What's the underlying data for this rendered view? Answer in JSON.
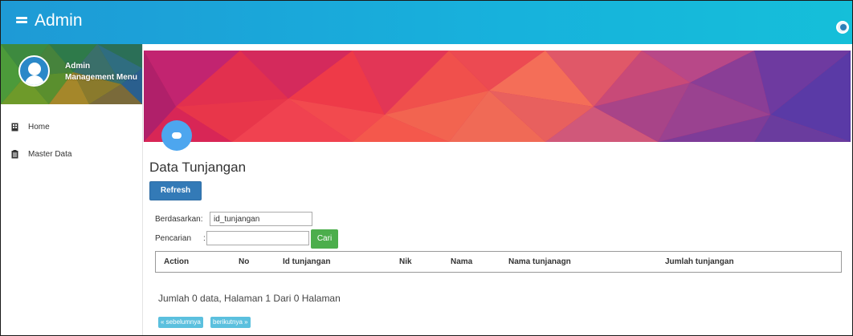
{
  "topbar": {
    "title": "Admin",
    "menu_icon": "menu-icon",
    "user_icon": "user-circle-icon"
  },
  "sidebar": {
    "profile": {
      "name": "Admin",
      "role": "Management Menu"
    },
    "items": [
      {
        "label": "Home",
        "icon": "building-icon"
      },
      {
        "label": "Master Data",
        "icon": "clipboard-icon"
      }
    ]
  },
  "main": {
    "title": "Data Tunjangan",
    "refresh_label": "Refresh",
    "filter": {
      "by_label": "Berdasarkan:",
      "by_value": "id_tunjangan",
      "search_label": "Pencarian",
      "search_value": "",
      "search_button": "Cari"
    },
    "table": {
      "columns": [
        "Action",
        "No",
        "Id tunjangan",
        "Nik",
        "Nama",
        "Nama tunjanagn",
        "Jumlah tunjangan"
      ],
      "rows": []
    },
    "summary": "Jumlah 0 data, Halaman 1 Dari 0 Halaman",
    "pagination": {
      "prev": "« sebelumnya",
      "next": "berikutnya »"
    }
  },
  "colors": {
    "topbar": "#1e9ad6",
    "primary_button": "#337ab7",
    "success_button": "#4cae4c",
    "info_button": "#5bc0de",
    "fab": "#4da6ef"
  }
}
